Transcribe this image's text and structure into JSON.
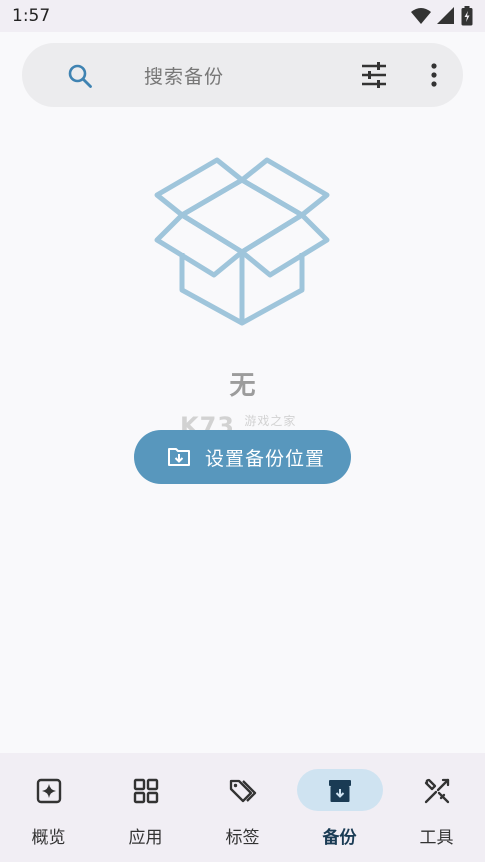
{
  "status_bar": {
    "time": "1:57"
  },
  "search": {
    "placeholder": "搜索备份"
  },
  "empty_state": {
    "message": "无",
    "button_label": "设置备份位置",
    "icon": "open-box-icon"
  },
  "watermark": {
    "brand": "K73",
    "subtitle": "游戏之家"
  },
  "bottom_nav": {
    "items": [
      {
        "label": "概览",
        "icon": "sparkle-box-icon",
        "active": false
      },
      {
        "label": "应用",
        "icon": "grid-icon",
        "active": false
      },
      {
        "label": "标签",
        "icon": "tags-icon",
        "active": false
      },
      {
        "label": "备份",
        "icon": "archive-icon",
        "active": true
      },
      {
        "label": "工具",
        "icon": "tools-icon",
        "active": false
      }
    ]
  },
  "colors": {
    "accent": "#5897bd",
    "box_outline": "#9fc5db",
    "active_indicator": "#cfe3f1"
  }
}
